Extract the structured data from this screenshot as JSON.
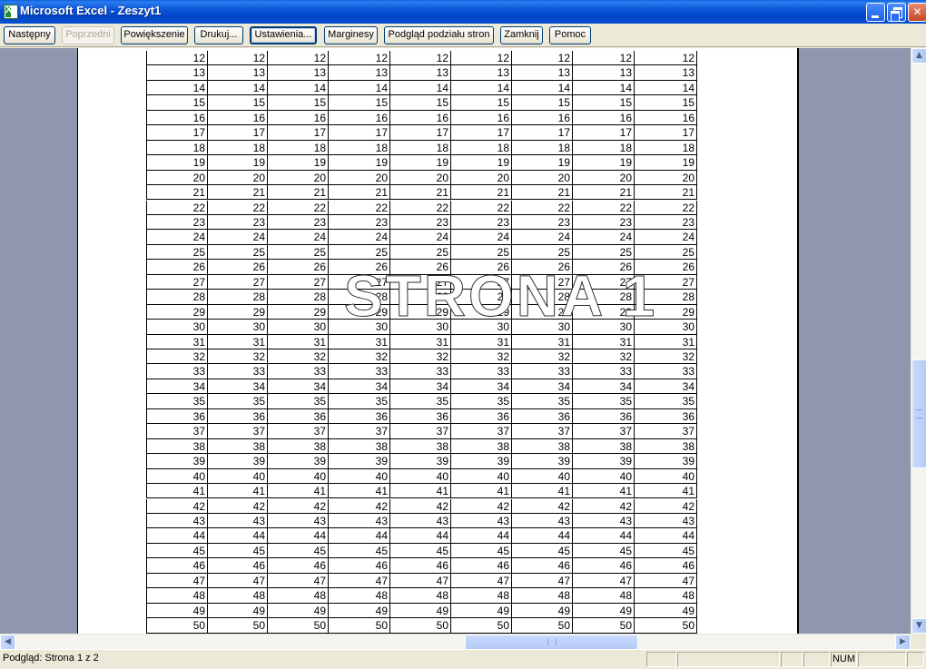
{
  "window": {
    "title": "Microsoft Excel - Zeszyt1"
  },
  "toolbar": {
    "next": "Następny",
    "previous": "Poprzedni",
    "zoom": "Powiększenie",
    "print": "Drukuj...",
    "setup": "Ustawienia...",
    "margins": "Marginesy",
    "page_break_preview": "Podgląd podziału stron",
    "close": "Zamknij",
    "help": "Pomoc"
  },
  "sheet": {
    "watermark": "STRONA 1",
    "row_values": [
      12,
      13,
      14,
      15,
      16,
      17,
      18,
      19,
      20,
      21,
      22,
      23,
      24,
      25,
      26,
      27,
      28,
      29,
      30,
      31,
      32,
      33,
      34,
      35,
      36,
      37,
      38,
      39,
      40,
      41,
      42,
      43,
      44,
      45,
      46,
      47,
      48,
      49,
      50
    ],
    "columns_per_row": 9
  },
  "statusbar": {
    "text": "Podgląd: Strona 1 z 2",
    "num": "NUM"
  },
  "colors": {
    "titlebar": "#0a55d6",
    "preview_background": "#8e97ae",
    "window_face": "#ece9d8"
  }
}
